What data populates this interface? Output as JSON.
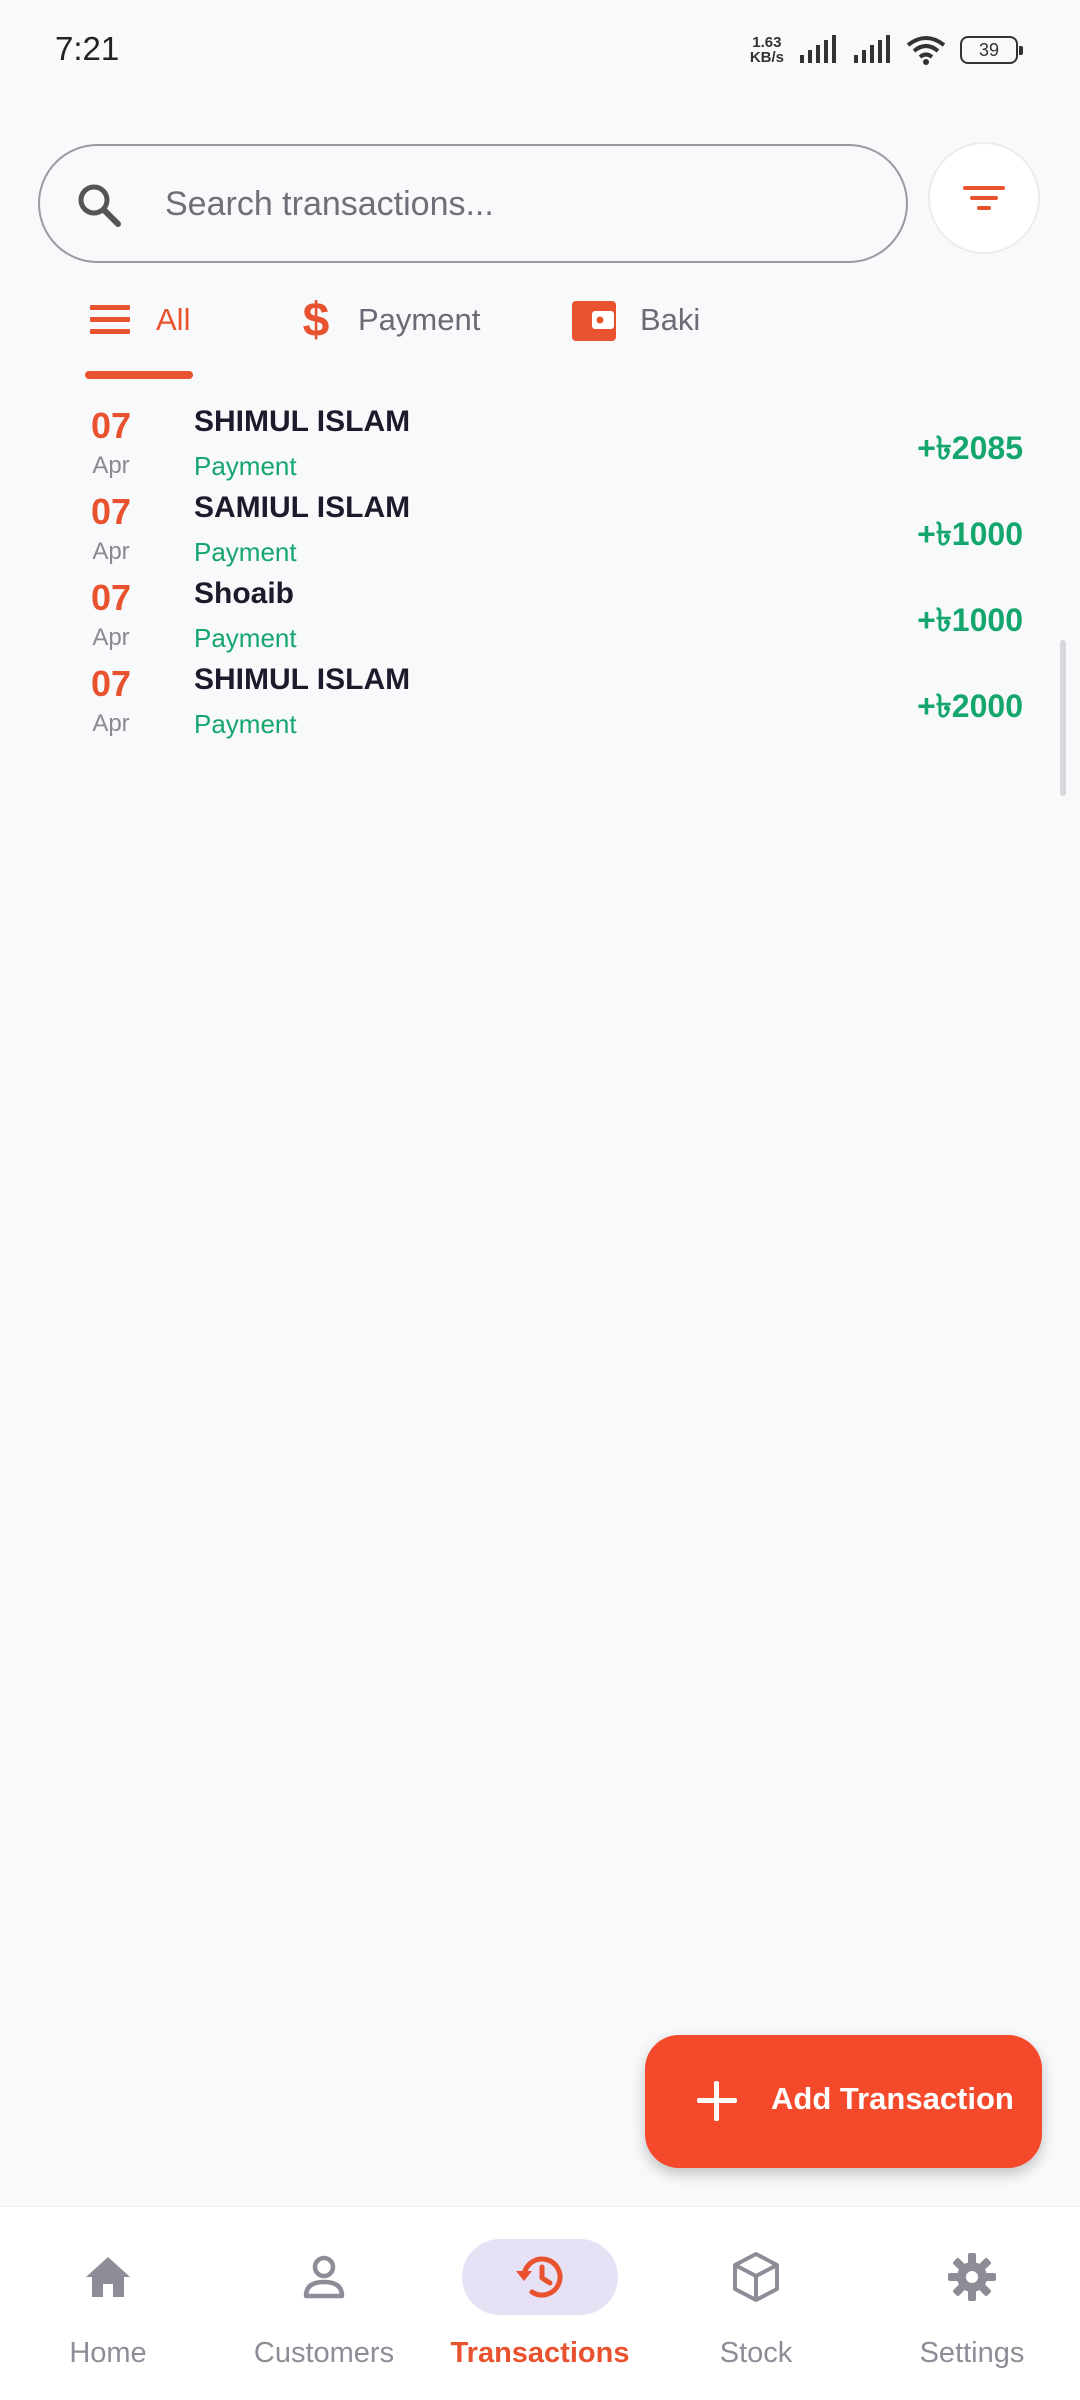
{
  "status_bar": {
    "time": "7:21",
    "speed_value": "1.63",
    "speed_unit": "KB/s",
    "battery": "39"
  },
  "search": {
    "placeholder": "Search transactions...",
    "value": ""
  },
  "tabs": [
    {
      "label": "All",
      "icon": "menu-lines-icon",
      "active": true
    },
    {
      "label": "Payment",
      "icon": "dollar-icon",
      "active": false
    },
    {
      "label": "Baki",
      "icon": "wallet-icon",
      "active": false
    }
  ],
  "transactions": [
    {
      "day": "07",
      "month": "Apr",
      "name": "SHIMUL ISLAM",
      "type": "Payment",
      "amount": "+৳2085"
    },
    {
      "day": "07",
      "month": "Apr",
      "name": "SAMIUL ISLAM",
      "type": "Payment",
      "amount": "+৳1000"
    },
    {
      "day": "07",
      "month": "Apr",
      "name": "Shoaib",
      "type": "Payment",
      "amount": "+৳1000"
    },
    {
      "day": "07",
      "month": "Apr",
      "name": "SHIMUL ISLAM",
      "type": "Payment",
      "amount": "+৳2000"
    }
  ],
  "fab": {
    "label": "Add Transaction",
    "icon": "plus-icon"
  },
  "bottom_nav": [
    {
      "label": "Home",
      "icon": "home-icon",
      "active": false
    },
    {
      "label": "Customers",
      "icon": "person-icon",
      "active": false
    },
    {
      "label": "Transactions",
      "icon": "history-icon",
      "active": true
    },
    {
      "label": "Stock",
      "icon": "box-icon",
      "active": false
    },
    {
      "label": "Settings",
      "icon": "gear-icon",
      "active": false
    }
  ],
  "colors": {
    "accent": "#e8522f",
    "fab": "#f4492a",
    "positive": "#15a66e",
    "active_nav_pill": "#e7e1f6",
    "background": "#f8f9fb"
  }
}
